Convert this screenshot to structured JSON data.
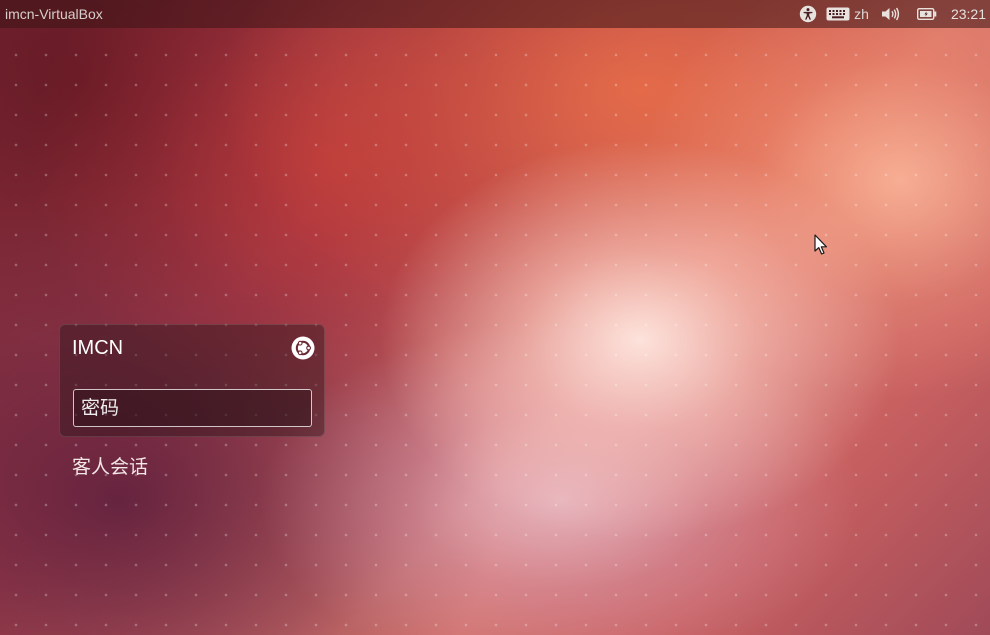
{
  "top_panel": {
    "hostname": "imcn-VirtualBox",
    "language": "zh",
    "clock": "23:21",
    "icons": {
      "accessibility": "accessibility-icon",
      "keyboard": "keyboard-icon",
      "sound": "speaker-volume-icon",
      "battery": "battery-icon"
    }
  },
  "login": {
    "user_name": "IMCN",
    "password_placeholder": "密码",
    "session_icon": "ubuntu-session-icon",
    "guest_session_label": "客人会话"
  },
  "colors": {
    "panel_bg": "#3c1416",
    "text": "#ffffff",
    "wallpaper_accent": "#dd4814"
  }
}
